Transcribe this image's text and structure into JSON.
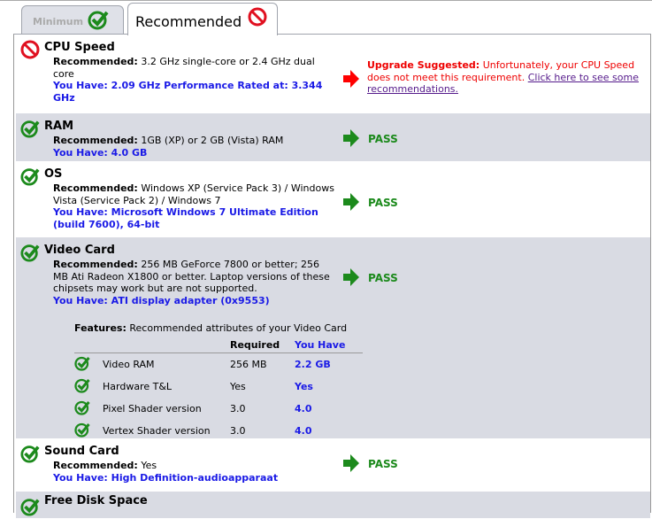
{
  "tabs": [
    {
      "label": "Minimum",
      "icon": "check-icon",
      "active": false
    },
    {
      "label": "Recommended",
      "icon": "no-icon",
      "active": true
    }
  ],
  "colors": {
    "pass": "#1c8a1c",
    "fail": "#e00000",
    "have": "#1a1ae6",
    "row_gray": "#d9dbe3"
  },
  "rows": [
    {
      "title": "CPU Speed",
      "rec_label": "Recommended:",
      "rec": " 3.2 GHz single-core or 2.4 GHz dual core",
      "have": "You Have: 2.09 GHz Performance Rated at: 3.344 GHz",
      "status_label": "Upgrade Suggested:",
      "status_text": " Unfortunately, your CPU Speed does not meet this requirement. ",
      "link": "Click here to see some recommendations."
    },
    {
      "title": "RAM",
      "rec_label": "Recommended:",
      "rec": " 1GB (XP) or 2 GB (Vista) RAM",
      "have": "You Have: 4.0 GB",
      "status": "PASS"
    },
    {
      "title": "OS",
      "rec_label": "Recommended:",
      "rec": " Windows XP (Service Pack 3) / Windows Vista (Service Pack 2) / Windows 7",
      "have": "You Have: Microsoft Windows 7 Ultimate Edition (build 7600), 64-bit",
      "status": "PASS"
    },
    {
      "title": "Video Card",
      "rec_label": "Recommended:",
      "rec": " 256 MB GeForce 7800 or better; 256 MB Ati Radeon X1800 or better. Laptop versions of these chipsets may work but are not supported.",
      "have": "You Have: ATI display adapter (0x9553)",
      "status": "PASS",
      "features": {
        "label": "Features:",
        "text": " Recommended attributes of your Video Card",
        "col_required": "Required",
        "col_have": "You Have",
        "items": [
          {
            "name": "Video RAM",
            "required": "256 MB",
            "have": "2.2 GB"
          },
          {
            "name": "Hardware T&L",
            "required": "Yes",
            "have": "Yes"
          },
          {
            "name": "Pixel Shader version",
            "required": "3.0",
            "have": "4.0"
          },
          {
            "name": "Vertex Shader version",
            "required": "3.0",
            "have": "4.0"
          }
        ]
      }
    },
    {
      "title": "Sound Card",
      "rec_label": "Recommended:",
      "rec": " Yes",
      "have": "You Have: High Definition-audioapparaat",
      "status": "PASS"
    },
    {
      "title": "Free Disk Space"
    }
  ]
}
